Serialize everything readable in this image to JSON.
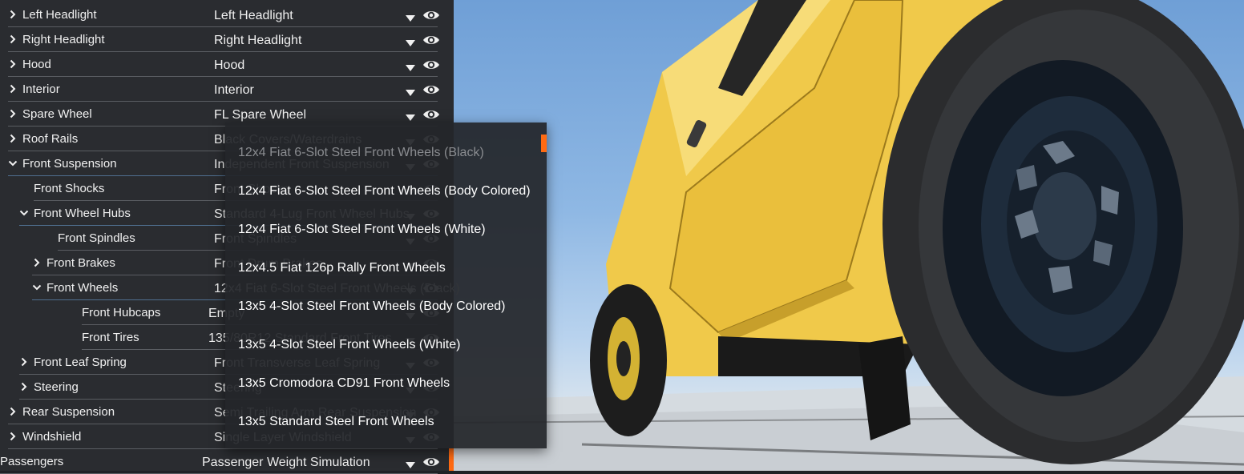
{
  "tree": [
    {
      "label": "Left Headlight",
      "value": "Left Headlight",
      "expanded": false,
      "depth": 0,
      "has_toggle": true
    },
    {
      "label": "Right Headlight",
      "value": "Right Headlight",
      "expanded": false,
      "depth": 0,
      "has_toggle": true
    },
    {
      "label": "Hood",
      "value": "Hood",
      "expanded": false,
      "depth": 0,
      "has_toggle": true
    },
    {
      "label": "Interior",
      "value": "Interior",
      "expanded": false,
      "depth": 0,
      "has_toggle": true
    },
    {
      "label": "Spare Wheel",
      "value": "FL Spare Wheel",
      "expanded": false,
      "depth": 0,
      "has_toggle": true
    },
    {
      "label": "Roof Rails",
      "value": "Black Covers/Waterdrains",
      "expanded": false,
      "depth": 0,
      "has_toggle": true
    },
    {
      "label": "Front Suspension",
      "value": "Independent Front Suspension",
      "expanded": true,
      "depth": 0,
      "has_toggle": true
    },
    {
      "label": "Front Shocks",
      "value": "Front Shocks",
      "expanded": false,
      "depth": 1,
      "has_toggle": false
    },
    {
      "label": "Front Wheel Hubs",
      "value": "Standard 4-Lug Front Wheel Hubs",
      "expanded": true,
      "depth": 1,
      "has_toggle": true
    },
    {
      "label": "Front Spindles",
      "value": "Front Spindles",
      "expanded": false,
      "depth": 2,
      "has_toggle": false
    },
    {
      "label": "Front Brakes",
      "value": "Front Drum Brakes",
      "expanded": false,
      "depth": 2,
      "has_toggle": true
    },
    {
      "label": "Front Wheels",
      "value": "12x4 Fiat 6-Slot Steel Front Wheels (Black)",
      "expanded": true,
      "depth": 2,
      "has_toggle": true
    },
    {
      "label": "Front Hubcaps",
      "value": "Empty",
      "expanded": false,
      "depth": 3,
      "has_toggle": false
    },
    {
      "label": "Front Tires",
      "value": "135/80R12 Standard Front Tires",
      "expanded": false,
      "depth": 3,
      "has_toggle": false
    },
    {
      "label": "Front Leaf Spring",
      "value": "Front Transverse Leaf Spring",
      "expanded": false,
      "depth": 1,
      "has_toggle": true
    },
    {
      "label": "Steering",
      "value": "Steering",
      "expanded": false,
      "depth": 1,
      "has_toggle": true
    },
    {
      "label": "Rear Suspension",
      "value": "Semi Trailing Arm Rear Suspension",
      "expanded": false,
      "depth": 0,
      "has_toggle": true
    },
    {
      "label": "Windshield",
      "value": "Single Layer Windshield",
      "expanded": false,
      "depth": 0,
      "has_toggle": true
    },
    {
      "label": "Passengers",
      "value": "Passenger Weight Simulation",
      "expanded": false,
      "depth": 0,
      "has_toggle": false
    }
  ],
  "dropdown_options": [
    {
      "label": "12x4 Fiat 6-Slot Steel Front Wheels (Black)",
      "selected": true
    },
    {
      "label": "12x4 Fiat 6-Slot Steel Front Wheels (Body Colored)",
      "selected": false
    },
    {
      "label": "12x4 Fiat 6-Slot Steel Front Wheels (White)",
      "selected": false
    },
    {
      "label": "12x4.5 Fiat 126p Rally Front Wheels",
      "selected": false
    },
    {
      "label": "13x5 4-Slot Steel Front Wheels (Body Colored)",
      "selected": false
    },
    {
      "label": "13x5 4-Slot Steel Front Wheels (White)",
      "selected": false
    },
    {
      "label": "13x5 Cromodora CD91 Front Wheels",
      "selected": false
    },
    {
      "label": "13x5 Standard Steel Front Wheels",
      "selected": false
    }
  ],
  "colors": {
    "accent": "#ff6a12",
    "panel": "#2a2c30",
    "car_body": "#f2cd4f",
    "sky": "#8fb8e4"
  },
  "icons": {
    "expand": "chevron-right-icon",
    "collapse": "chevron-down-icon",
    "dropdown": "caret-down-icon",
    "visibility": "eye-icon"
  }
}
